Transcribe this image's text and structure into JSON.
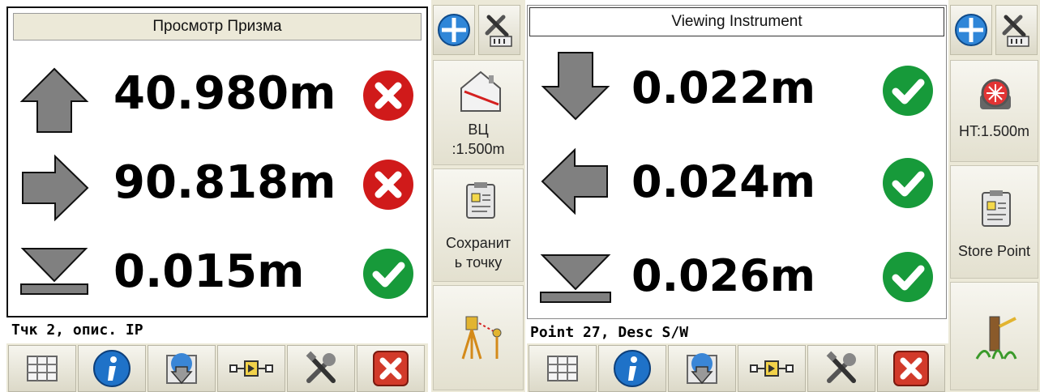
{
  "left": {
    "title": "Просмотр Призма",
    "rows": [
      {
        "value": "40.980m",
        "arrow": "arrow-up-icon",
        "ok": false
      },
      {
        "value": "90.818m",
        "arrow": "arrow-right-icon",
        "ok": false
      },
      {
        "value": "0.015m",
        "arrow": "cut-fill-icon",
        "ok": true
      }
    ],
    "footer": "Тчк 2, опис. IP",
    "side": {
      "height_label_1": "ВЦ",
      "height_label_2": ":1.500m",
      "store_label_1": "Сохранит",
      "store_label_2": "ь точку"
    }
  },
  "right": {
    "title": "Viewing Instrument",
    "rows": [
      {
        "value": "0.022m",
        "arrow": "arrow-down-icon",
        "ok": true
      },
      {
        "value": "0.024m",
        "arrow": "arrow-left-icon",
        "ok": true
      },
      {
        "value": "0.026m",
        "arrow": "cut-fill-icon",
        "ok": true
      }
    ],
    "footer": "Point 27, Desc S/W",
    "side": {
      "height_label": "HT:1.500m",
      "store_label": "Store Point"
    }
  },
  "toolbar_icons": [
    "grid-icon",
    "info-icon",
    "map-download-icon",
    "stakeout-line-icon",
    "tools-icon",
    "close-icon"
  ],
  "colors": {
    "arrow_fill": "#808080",
    "fail": "#d01a1a",
    "ok": "#179a3a",
    "chrome": "#ece9d8"
  }
}
